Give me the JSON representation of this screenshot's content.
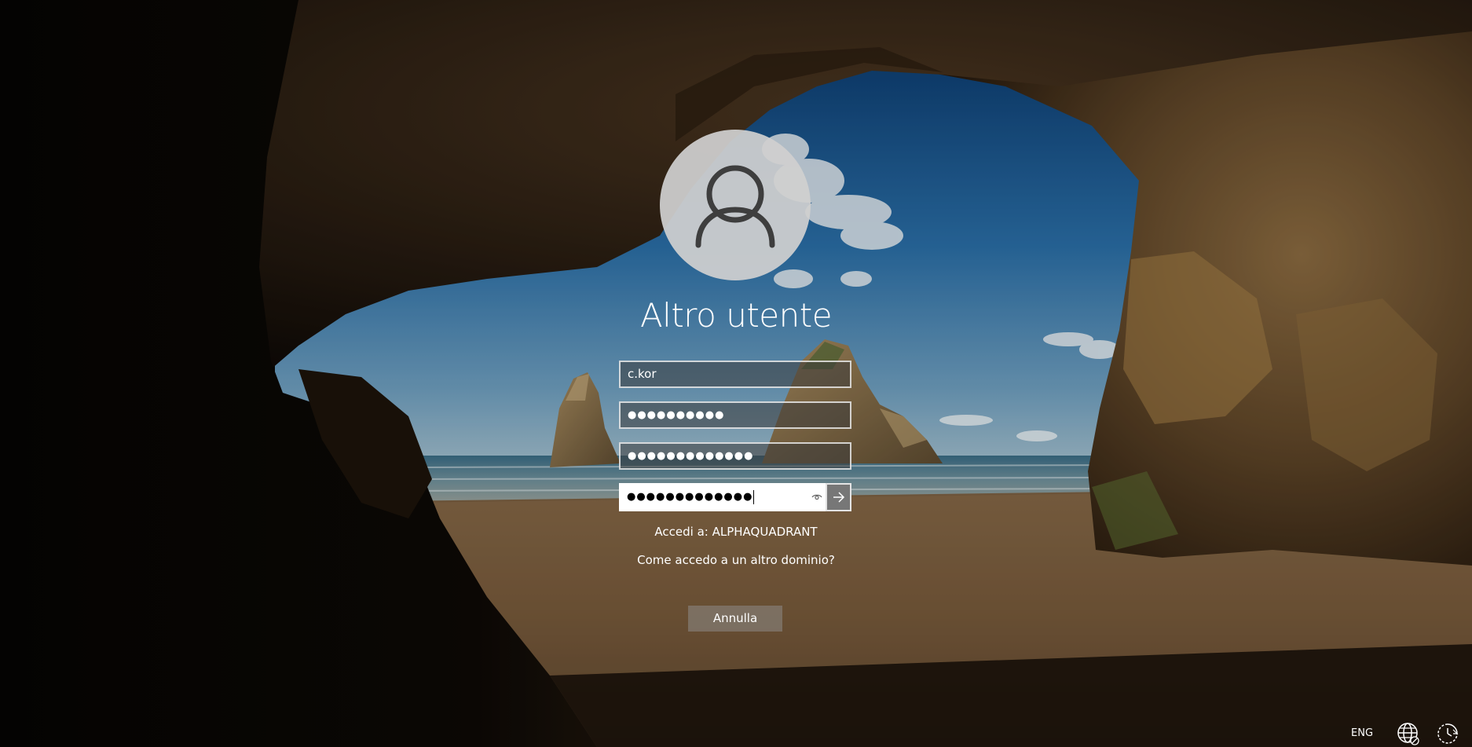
{
  "login": {
    "title": "Altro utente",
    "username_value": "c.kor",
    "password1_value": "●●●●●●●●●●",
    "password2_value": "●●●●●●●●●●●●●",
    "password_active_value": "●●●●●●●●●●●●●",
    "domain_text": "Accedi a: ALPHAQUADRANT",
    "other_domain_link": "Come accedo a un altro dominio?",
    "cancel_label": "Annulla"
  },
  "tray": {
    "language": "ENG"
  },
  "icons": {
    "avatar": "user-silhouette-icon",
    "reveal": "eye-icon",
    "submit": "arrow-right-icon",
    "network": "globe-network-icon",
    "accessibility": "ease-of-access-icon"
  }
}
